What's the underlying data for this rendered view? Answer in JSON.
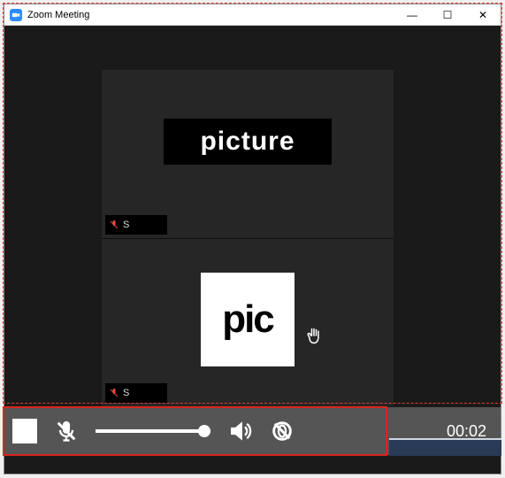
{
  "window": {
    "title": "Zoom Meeting"
  },
  "participants": [
    {
      "placeholder_label": "picture",
      "placeholder_style": "dark",
      "name_prefix": "S",
      "muted": true,
      "hand_raised": false
    },
    {
      "placeholder_label": "pic",
      "placeholder_style": "light",
      "name_prefix": "S",
      "muted": true,
      "hand_raised": true
    }
  ],
  "media_controls": {
    "timer": "00:02",
    "volume_percent": 100,
    "mic_muted": true,
    "camera_off": true
  },
  "icons": {
    "zoom": "zoom-icon",
    "minimize": "—",
    "maximize": "☐",
    "close": "✕",
    "hand": "✋"
  }
}
